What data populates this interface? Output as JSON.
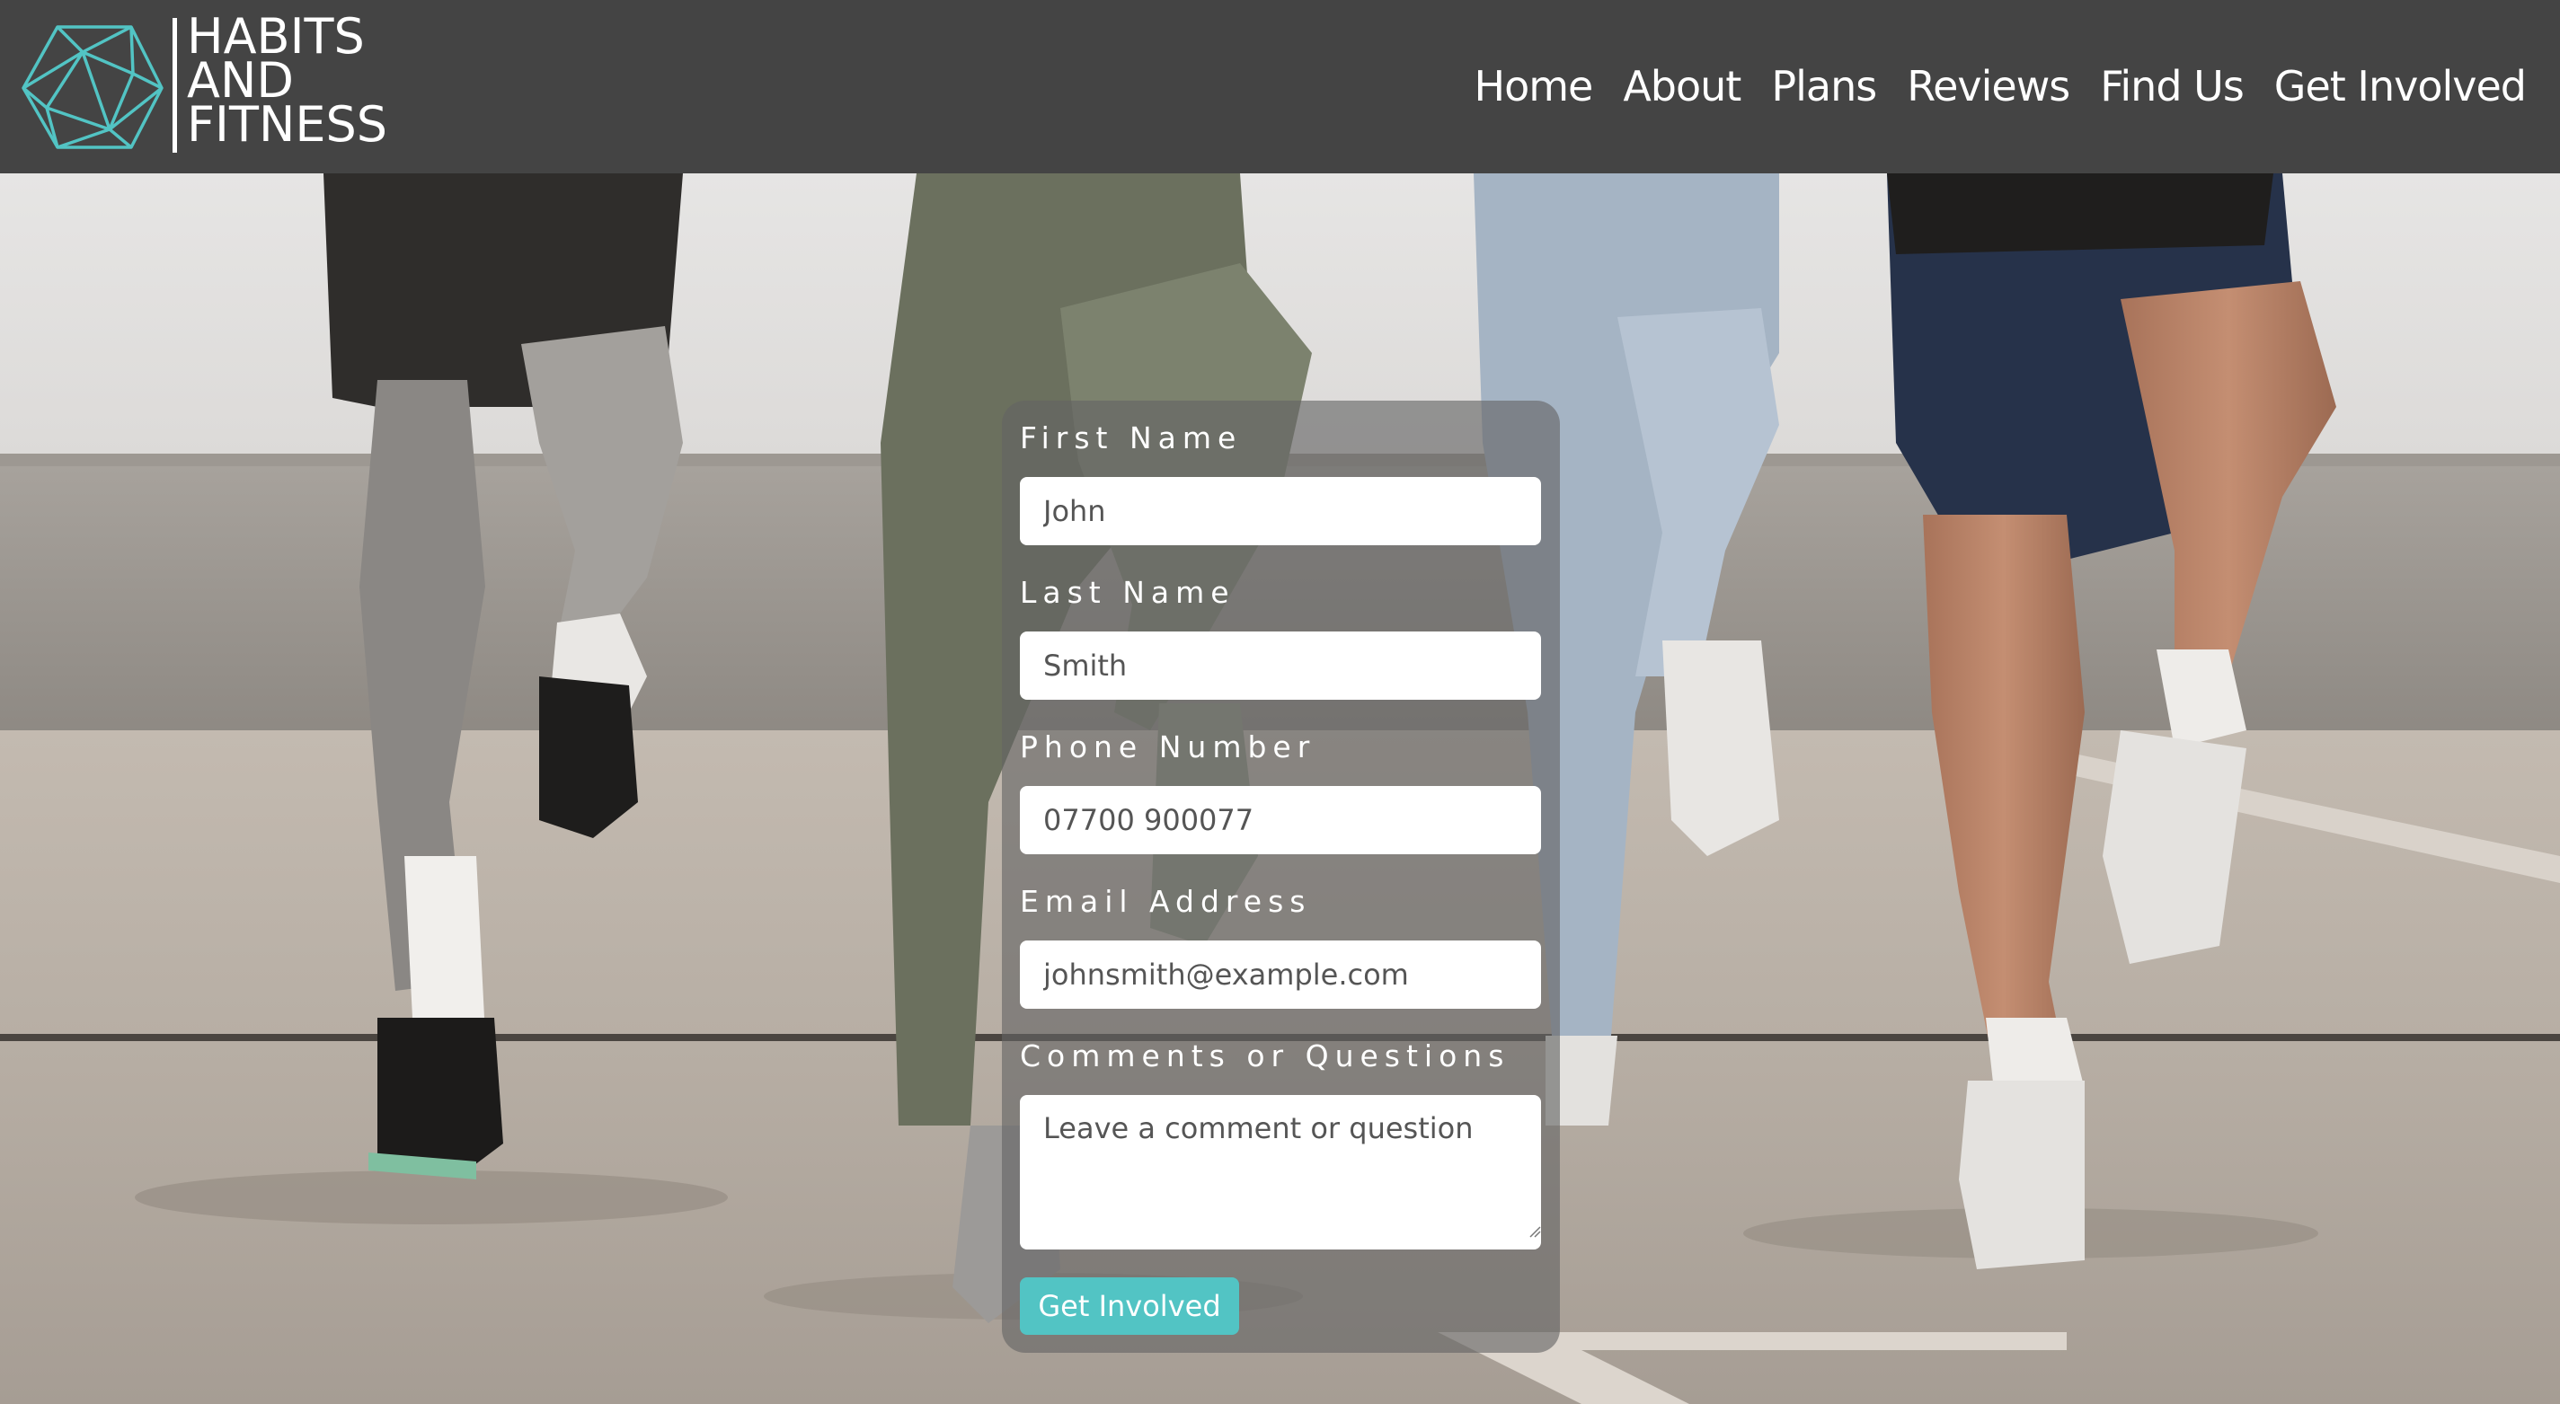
{
  "brand": {
    "logo_lines": [
      "HABITS",
      "AND",
      "FITNESS"
    ],
    "accent_color": "#52c4c4",
    "header_color": "#444444",
    "logo_icon": "icosahedron-icon"
  },
  "nav": {
    "items": [
      {
        "label": "Home"
      },
      {
        "label": "About"
      },
      {
        "label": "Plans"
      },
      {
        "label": "Reviews"
      },
      {
        "label": "Find Us"
      },
      {
        "label": "Get Involved"
      }
    ]
  },
  "form": {
    "first_name": {
      "label": "First Name",
      "placeholder": "John"
    },
    "last_name": {
      "label": "Last Name",
      "placeholder": "Smith"
    },
    "phone": {
      "label": "Phone Number",
      "placeholder": "07700 900077"
    },
    "email": {
      "label": "Email Address",
      "placeholder": "johnsmith@example.com"
    },
    "comments": {
      "label": "Comments or Questions",
      "placeholder": "Leave a comment or question"
    },
    "submit_label": "Get Involved"
  }
}
